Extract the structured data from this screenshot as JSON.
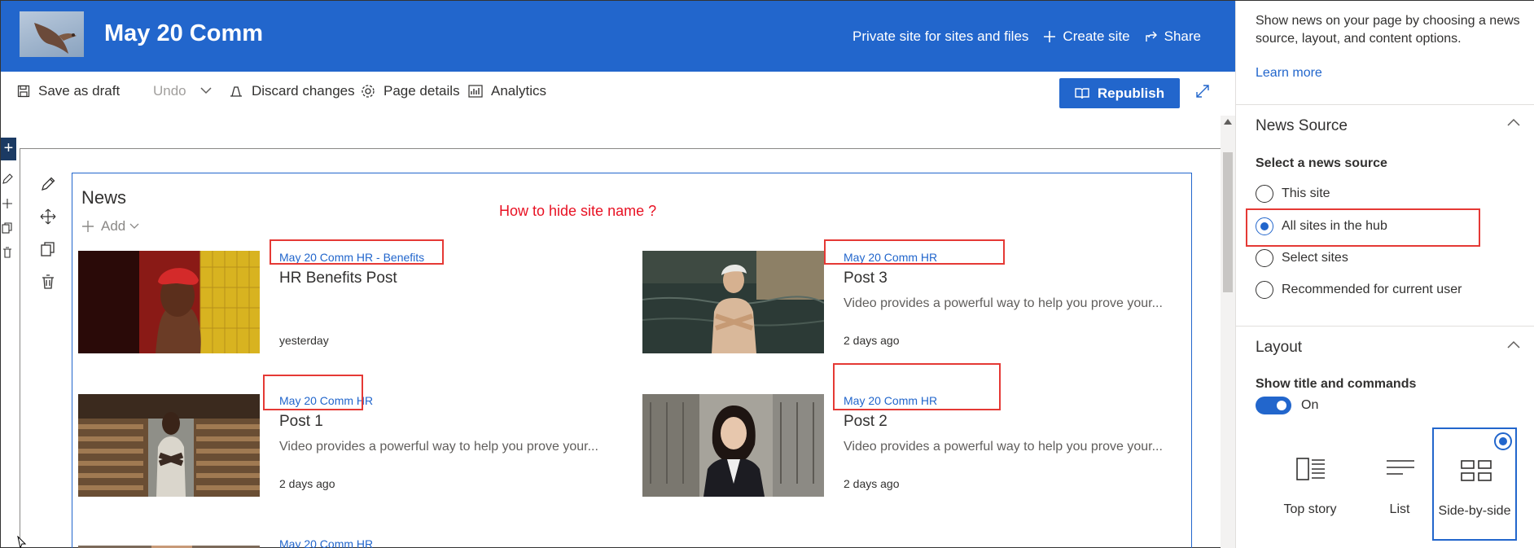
{
  "header": {
    "site_title": "May 20 Comm",
    "privacy_label": "Private site for sites and files",
    "create_site_label": "Create site",
    "share_label": "Share"
  },
  "toolbar": {
    "save_draft_label": "Save as draft",
    "undo_label": "Undo",
    "discard_label": "Discard changes",
    "page_details_label": "Page details",
    "analytics_label": "Analytics",
    "republish_label": "Republish"
  },
  "webpart": {
    "title": "News",
    "add_label": "Add",
    "annotation": "How to hide site name ?",
    "cards": [
      {
        "site": "May 20 Comm HR - Benefits",
        "title": "HR Benefits Post",
        "description": "",
        "date": "yesterday",
        "image": "woman-red-headscarf"
      },
      {
        "site": "May 20 Comm HR",
        "title": "Post 3",
        "description": "Video provides a powerful way to help you prove your...",
        "date": "2 days ago",
        "image": "woman-by-water"
      },
      {
        "site": "May 20 Comm HR",
        "title": "Post 1",
        "description": "Video provides a powerful way to help you prove your...",
        "date": "2 days ago",
        "image": "man-in-warehouse"
      },
      {
        "site": "May 20 Comm HR",
        "title": "Post 2",
        "description": "Video provides a powerful way to help you prove your...",
        "date": "2 days ago",
        "image": "woman-city-street"
      },
      {
        "site": "May 20 Comm HR",
        "title": "",
        "description": "",
        "date": "",
        "image": "partial"
      }
    ]
  },
  "pane": {
    "intro": "Show news on your page by choosing a news source, layout, and content options.",
    "learn_more": "Learn more",
    "news_source": {
      "heading": "News Source",
      "field_label": "Select a news source",
      "options": [
        "This site",
        "All sites in the hub",
        "Select sites",
        "Recommended for current user"
      ],
      "selected": "All sites in the hub"
    },
    "layout": {
      "heading": "Layout",
      "show_title_label": "Show title and commands",
      "toggle_state": "On",
      "options": [
        "Top story",
        "List",
        "Side-by-side"
      ],
      "selected": "Side-by-side"
    }
  },
  "colors": {
    "brand_blue": "#2266cc",
    "annotation_red": "#e53935"
  }
}
